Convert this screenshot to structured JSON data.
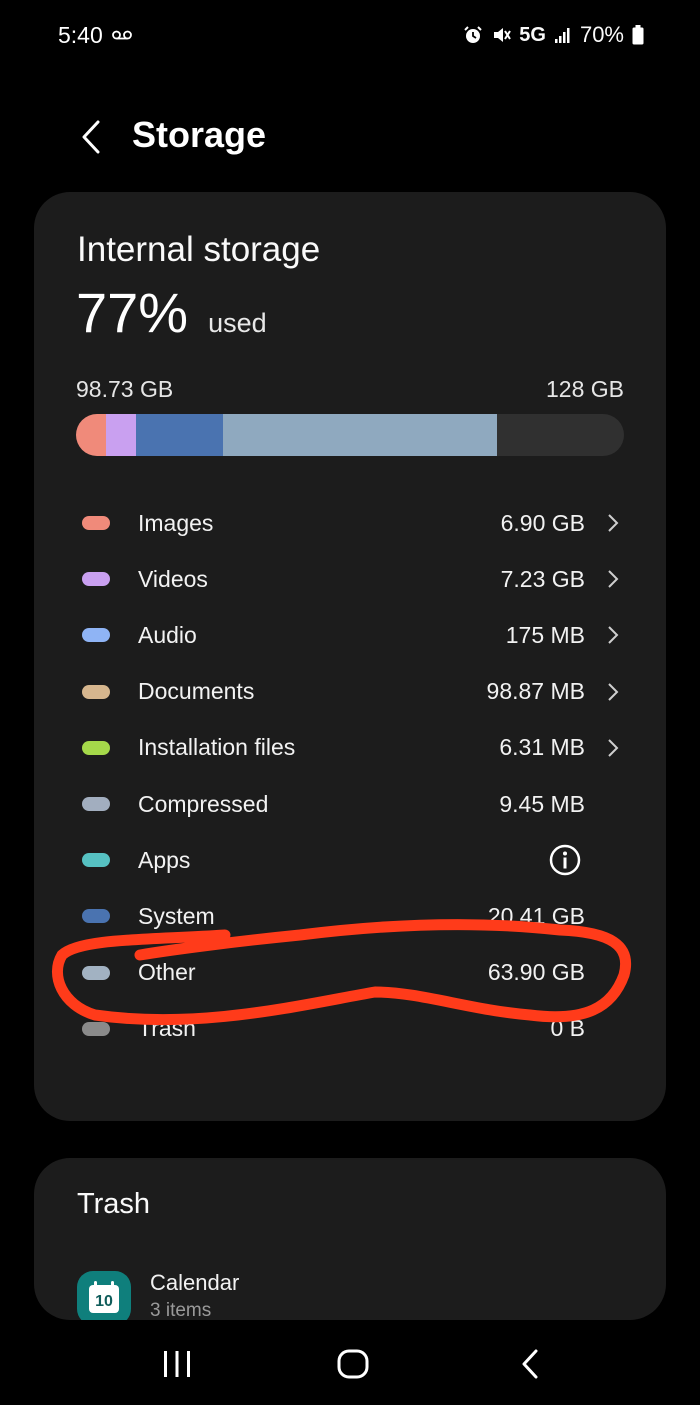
{
  "status_bar": {
    "time": "5:40",
    "network": "5G",
    "battery": "70%"
  },
  "header": {
    "title": "Storage"
  },
  "storage": {
    "heading": "Internal storage",
    "percent": "77%",
    "percent_suffix": "used",
    "used": "98.73 GB",
    "total": "128 GB",
    "bar_segments": [
      {
        "name": "images",
        "fraction": 0.054,
        "color": "#f08a7a"
      },
      {
        "name": "videos",
        "fraction": 0.056,
        "color": "#c9a0f0"
      },
      {
        "name": "system",
        "fraction": 0.159,
        "color": "#4a73b0"
      },
      {
        "name": "other",
        "fraction": 0.5,
        "color": "#8fa9bf"
      }
    ],
    "categories": [
      {
        "label": "Images",
        "size": "6.90 GB",
        "color": "#f08a7a",
        "action": "chevron"
      },
      {
        "label": "Videos",
        "size": "7.23 GB",
        "color": "#c9a0f0",
        "action": "chevron"
      },
      {
        "label": "Audio",
        "size": "175 MB",
        "color": "#8fb4f5",
        "action": "chevron"
      },
      {
        "label": "Documents",
        "size": "98.87 MB",
        "color": "#d6b68e",
        "action": "chevron"
      },
      {
        "label": "Installation files",
        "size": "6.31 MB",
        "color": "#a5d94a",
        "action": "chevron"
      },
      {
        "label": "Compressed",
        "size": "9.45 MB",
        "color": "#a2aebf",
        "action": "none"
      },
      {
        "label": "Apps",
        "size": "",
        "color": "#56c1c2",
        "action": "info"
      },
      {
        "label": "System",
        "size": "20.41 GB",
        "color": "#4a73b0",
        "action": "none"
      },
      {
        "label": "Other",
        "size": "63.90 GB",
        "color": "#a2b2c2",
        "action": "none"
      },
      {
        "label": "Trash",
        "size": "0 B",
        "color": "#8a8a8a",
        "action": "none"
      }
    ]
  },
  "trash": {
    "heading": "Trash",
    "items": [
      {
        "name": "Calendar",
        "count": "3 items",
        "day": "10"
      }
    ]
  },
  "colors": {
    "annotation": "#ff3b1a",
    "card": "#1c1c1c"
  }
}
